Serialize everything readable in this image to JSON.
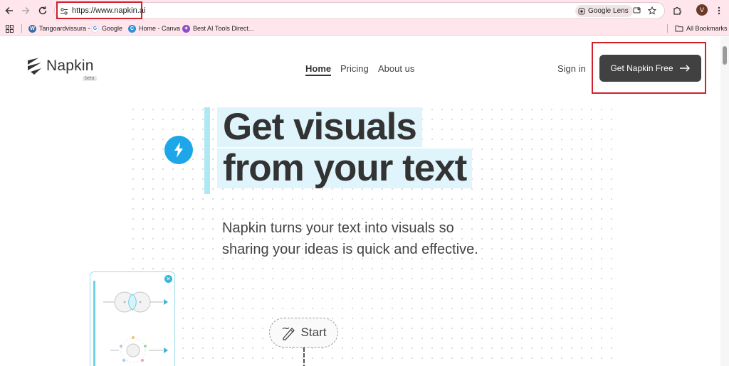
{
  "browser": {
    "url": "https://www.napkin.ai",
    "lens_label": "Google Lens",
    "avatar_initial": "V",
    "bookmarks": [
      {
        "label": "Tangoardvissura -",
        "icon": "wordpress-icon"
      },
      {
        "label": "Google",
        "icon": "google-icon"
      },
      {
        "label": "Home - Canva",
        "icon": "canva-icon"
      },
      {
        "label": "Best AI Tools Direct...",
        "icon": "ai-tools-icon"
      }
    ],
    "all_bookmarks_label": "All Bookmarks"
  },
  "site": {
    "logo_text": "Napkin",
    "beta_label": "beta",
    "nav": [
      {
        "label": "Home",
        "active": true
      },
      {
        "label": "Pricing",
        "active": false
      },
      {
        "label": "About us",
        "active": false
      }
    ],
    "sign_in_label": "Sign in",
    "cta_label": "Get Napkin Free"
  },
  "hero": {
    "headline_line1": "Get visuals",
    "headline_line2": "from your text",
    "subtext": "Napkin turns your text into visuals so sharing your ideas is quick and effective.",
    "start_label": "Start"
  },
  "colors": {
    "chrome_bg": "#ffe6ec",
    "highlight_red": "#d0202c",
    "cta_bg": "#414141",
    "accent_cyan": "#1ea7e8",
    "headline_highlight": "#dff4fb"
  }
}
